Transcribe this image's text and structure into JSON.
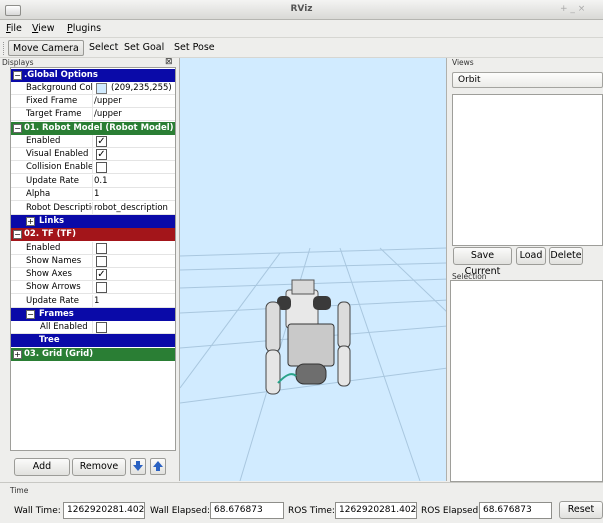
{
  "window": {
    "title": "RViz",
    "controls": "+ _ ×"
  },
  "menu": {
    "file": "File",
    "view": "View",
    "plugins": "Plugins"
  },
  "toolbar": {
    "move_camera": "Move Camera",
    "select": "Select",
    "set_goal": "Set Goal",
    "set_pose": "Set Pose"
  },
  "displays": {
    "label": "Displays",
    "close_glyph": "⊠",
    "global": {
      "title": ".Global Options",
      "background_color": {
        "key": "Background Colo",
        "value": "(209,235,255)",
        "color": "#d1ebff"
      },
      "fixed_frame": {
        "key": "Fixed Frame",
        "value": "/upper"
      },
      "target_frame": {
        "key": "Target Frame",
        "value": "/upper"
      }
    },
    "robot_model": {
      "title": "01. Robot Model (Robot Model)",
      "enabled": {
        "key": "Enabled",
        "checked": true
      },
      "visual_enabled": {
        "key": "Visual Enabled",
        "checked": true
      },
      "collision_enabled": {
        "key": "Collision Enablec",
        "checked": false
      },
      "update_rate": {
        "key": "Update Rate",
        "value": "0.1"
      },
      "alpha": {
        "key": "Alpha",
        "value": "1"
      },
      "robot_description": {
        "key": "Robot Descriptior",
        "value": "robot_description"
      },
      "links": "Links"
    },
    "tf": {
      "title": "02. TF (TF)",
      "enabled": {
        "key": "Enabled",
        "checked": false
      },
      "show_names": {
        "key": "Show Names",
        "checked": false
      },
      "show_axes": {
        "key": "Show Axes",
        "checked": true
      },
      "show_arrows": {
        "key": "Show Arrows",
        "checked": false
      },
      "update_rate": {
        "key": "Update Rate",
        "value": "1"
      },
      "frames": "Frames",
      "all_enabled": {
        "key": "All Enabled",
        "checked": false
      },
      "tree": "Tree"
    },
    "grid": {
      "title": "03. Grid (Grid)"
    },
    "buttons": {
      "add": "Add",
      "remove": "Remove"
    }
  },
  "views": {
    "label": "Views",
    "mode": "Orbit",
    "buttons": {
      "save_current": "Save Current",
      "load": "Load",
      "delete": "Delete"
    }
  },
  "selection": {
    "label": "Selection"
  },
  "time": {
    "label": "Time",
    "wall_time_label": "Wall Time:",
    "wall_time": "1262920281.40286",
    "wall_elapsed_label": "Wall Elapsed:",
    "wall_elapsed": "68.676873",
    "ros_time_label": "ROS Time:",
    "ros_time": "1262920281.402857",
    "ros_elapsed_label": "ROS Elapsed:",
    "ros_elapsed": "68.676873",
    "reset": "Reset"
  },
  "colors": {
    "global_header": "#0a0aa8",
    "robot_header": "#2a7e34",
    "tf_header": "#a3151a",
    "viewport_bg": "#d1ebff"
  }
}
